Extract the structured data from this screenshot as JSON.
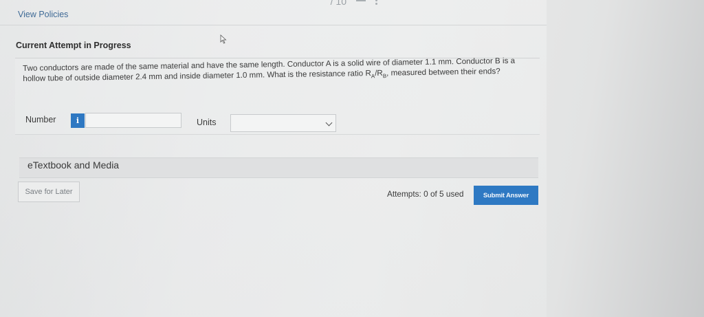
{
  "header": {
    "view_policies": "View Policies",
    "page_count": "/ 10"
  },
  "attempt": {
    "title": "Current Attempt in Progress"
  },
  "question": {
    "text_part1": "Two conductors are made of the same material and have the same length. Conductor A is a solid wire of diameter 1.1 mm. Conductor B is a hollow tube of outside diameter 2.4 mm and inside diameter 1.0 mm. What is the resistance ratio R",
    "sub_a": "A",
    "slash": "/R",
    "sub_b": "B",
    "text_part2": ", measured between their ends?"
  },
  "answer": {
    "number_label": "Number",
    "info_glyph": "i",
    "number_value": "",
    "units_label": "Units",
    "units_selected": ""
  },
  "etextbook": {
    "label": "eTextbook and Media"
  },
  "footer": {
    "save_label": "Save for Later",
    "attempts_text": "Attempts: 0 of 5 used",
    "submit_label": "Submit Answer"
  },
  "colors": {
    "accent": "#2e79c3",
    "link": "#3f6a96"
  }
}
